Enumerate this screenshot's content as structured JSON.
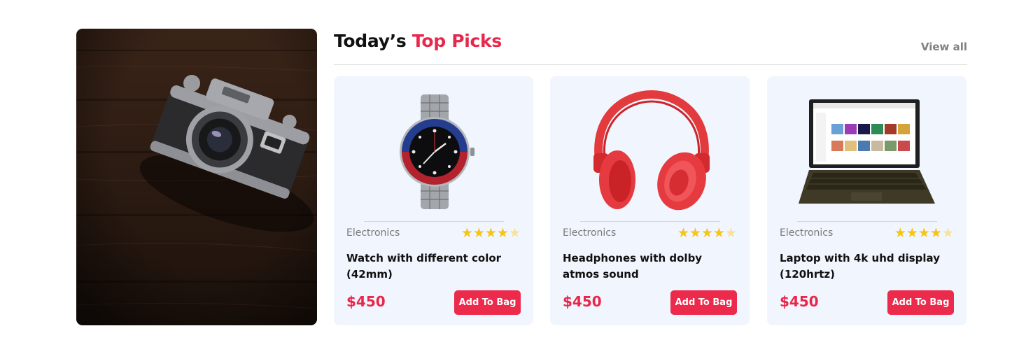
{
  "header": {
    "title_main": "Today’s",
    "title_accent": "Top Picks",
    "view_all": "View all"
  },
  "colors": {
    "accent": "#e8274b",
    "card_bg": "#f1f5fd",
    "star": "#f5c518"
  },
  "products": [
    {
      "category": "Electronics",
      "name": "Watch with different color (42mm)",
      "price": "$450",
      "button": "Add To Bag",
      "rating": 4,
      "icon": "watch-image"
    },
    {
      "category": "Electronics",
      "name": "Headphones with dolby atmos sound",
      "price": "$450",
      "button": "Add To Bag",
      "rating": 4,
      "icon": "headphones-image"
    },
    {
      "category": "Electronics",
      "name": "Laptop with 4k uhd display (120hrtz)",
      "price": "$450",
      "button": "Add To Bag",
      "rating": 4,
      "icon": "laptop-image"
    }
  ]
}
